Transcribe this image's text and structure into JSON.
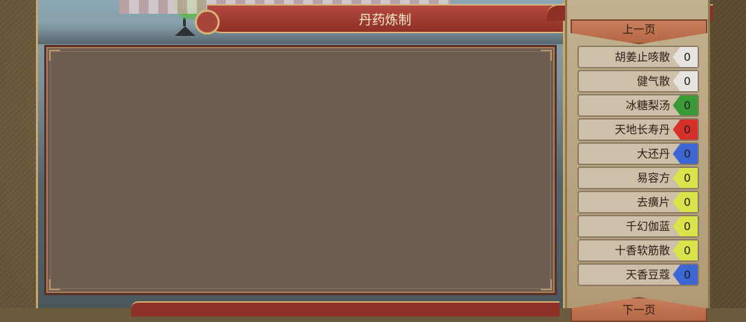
{
  "title": "丹药炼制",
  "nav": {
    "prev": "上一页",
    "next": "下一页"
  },
  "items": [
    {
      "name": "胡姜止咳散",
      "count": "0",
      "color": "#e6e3e0"
    },
    {
      "name": "健气散",
      "count": "0",
      "color": "#e6e3e0"
    },
    {
      "name": "冰糖梨汤",
      "count": "0",
      "color": "#3a9a35"
    },
    {
      "name": "天地长寿丹",
      "count": "0",
      "color": "#d6302a"
    },
    {
      "name": "大还丹",
      "count": "0",
      "color": "#3b66d4"
    },
    {
      "name": "易容方",
      "count": "0",
      "color": "#d9e34a"
    },
    {
      "name": "去癀片",
      "count": "0",
      "color": "#d9e34a"
    },
    {
      "name": "千幻伽蓝",
      "count": "0",
      "color": "#d9e34a"
    },
    {
      "name": "十香软筋散",
      "count": "0",
      "color": "#d9e34a"
    },
    {
      "name": "天香豆蔻",
      "count": "0",
      "color": "#3b66d4"
    }
  ]
}
